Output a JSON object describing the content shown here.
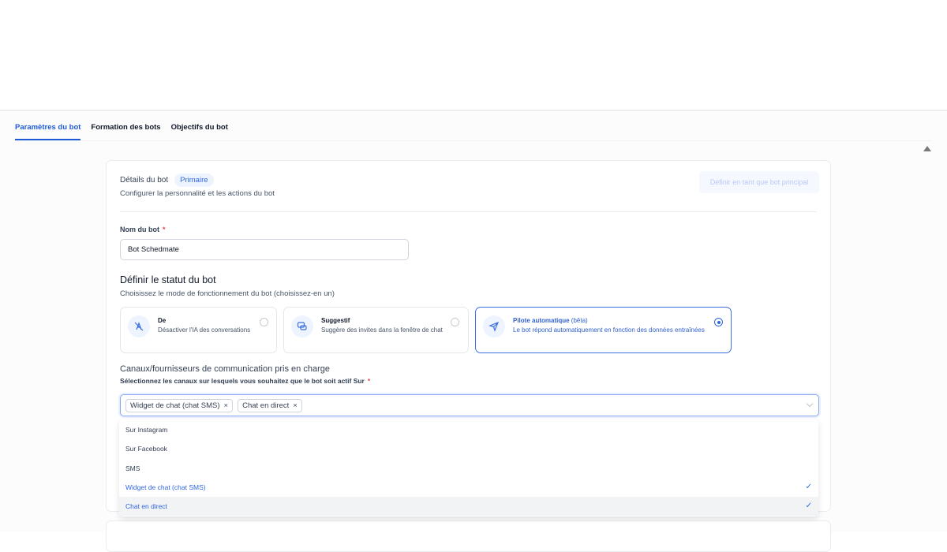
{
  "tabs": [
    {
      "label": "Paramètres du bot",
      "active": true
    },
    {
      "label": "Formation des bots"
    },
    {
      "label": "Objectifs du bot"
    }
  ],
  "details": {
    "title": "Détails du bot",
    "badge": "Primaire",
    "subtitle": "Configurer la personnalité et les actions du bot",
    "primary_button": "Définir en tant que bot principal"
  },
  "name": {
    "label": "Nom du bot",
    "required": "*",
    "value": "Bot Schedmate"
  },
  "status": {
    "title": "Définir le statut du bot",
    "subtitle": "Choisissez le mode de fonctionnement du bot (choisissez-en un)",
    "options": [
      {
        "title": "De",
        "desc": "Désactiver l'IA des conversations",
        "icon": "bot-off-icon",
        "selected": false
      },
      {
        "title": "Suggestif",
        "desc": "Suggère des invites dans la fenêtre de chat",
        "icon": "chat-bubbles-icon",
        "selected": false
      },
      {
        "title": "Pilote automatique",
        "tag": "(bêta)",
        "desc": "Le bot répond automatiquement en fonction des données entraînées",
        "icon": "send-icon",
        "selected": true
      }
    ]
  },
  "channels": {
    "title": "Canaux/fournisseurs de communication pris en charge",
    "subtitle": "Sélectionnez les canaux sur lesquels vous souhaitez que le bot soit actif Sur",
    "required": "*",
    "selected": [
      "Widget de chat (chat SMS)",
      "Chat en direct"
    ],
    "options": [
      {
        "label": "Sur Instagram",
        "selected": false
      },
      {
        "label": "Sur Facebook",
        "selected": false
      },
      {
        "label": "SMS",
        "selected": false
      },
      {
        "label": "Widget de chat (chat SMS)",
        "selected": true
      },
      {
        "label": "Chat en direct",
        "selected": true
      }
    ],
    "check": "✓",
    "remove": "×"
  },
  "colors": {
    "accent": "#2f66e0"
  }
}
